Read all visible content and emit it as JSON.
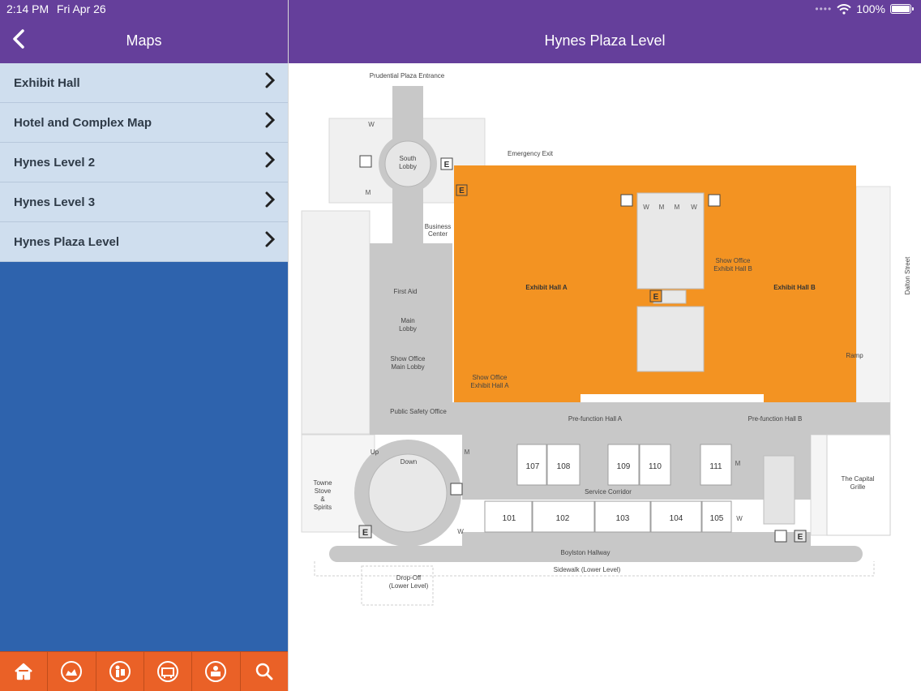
{
  "status": {
    "time": "2:14 PM",
    "date": "Fri Apr 26",
    "battery": "100%"
  },
  "left": {
    "title": "Maps",
    "back_icon": "chevron-left-icon",
    "items": [
      {
        "label": "Exhibit Hall"
      },
      {
        "label": "Hotel and Complex Map"
      },
      {
        "label": "Hynes Level 2"
      },
      {
        "label": "Hynes Level 3"
      },
      {
        "label": "Hynes Plaza Level"
      }
    ]
  },
  "tabbar": [
    {
      "icon": "home-icon"
    },
    {
      "icon": "exhibitors-icon"
    },
    {
      "icon": "speakers-icon"
    },
    {
      "icon": "sessions-icon"
    },
    {
      "icon": "attendees-icon"
    },
    {
      "icon": "search-icon"
    }
  ],
  "right": {
    "title": "Hynes Plaza Level"
  },
  "map": {
    "labels": {
      "prudential_entrance": "Prudential Plaza Entrance",
      "emergency_exit": "Emergency Exit",
      "south_lobby": [
        "South",
        "Lobby"
      ],
      "business_center": [
        "Business",
        "Center"
      ],
      "first_aid": "First Aid",
      "main_lobby": [
        "Main",
        "Lobby"
      ],
      "show_office_main": [
        "Show Office",
        "Main Lobby"
      ],
      "show_office_a": [
        "Show Office",
        "Exhibit Hall A"
      ],
      "show_office_b": [
        "Show Office",
        "Exhibit Hall B"
      ],
      "exhibit_hall_a": "Exhibit Hall A",
      "exhibit_hall_b": "Exhibit Hall B",
      "ramp": "Ramp",
      "dalton_street": "Dalton Street",
      "public_safety": "Public Safety Office",
      "prefunction_a": "Pre-function Hall A",
      "prefunction_b": "Pre-function Hall B",
      "service_corridor": "Service Corridor",
      "boylston_hallway": "Boylston Hallway",
      "sidewalk": "Sidewalk (Lower Level)",
      "dropoff": [
        "Drop-Off",
        "(Lower Level)"
      ],
      "towne_stove": [
        "Towne",
        "Stove",
        "&",
        "Spirits"
      ],
      "capital_grille": [
        "The Capital",
        "Grille"
      ],
      "up": "Up",
      "down": "Down",
      "elevator": "E",
      "women": "W",
      "men": "M"
    },
    "rooms_top": [
      "107",
      "108",
      "109",
      "110",
      "111"
    ],
    "rooms_bottom": [
      "101",
      "102",
      "103",
      "104",
      "105"
    ],
    "colors": {
      "exhibit": "#f39322",
      "corridor": "#c8c8c8",
      "structure": "#e6e6e6"
    }
  }
}
